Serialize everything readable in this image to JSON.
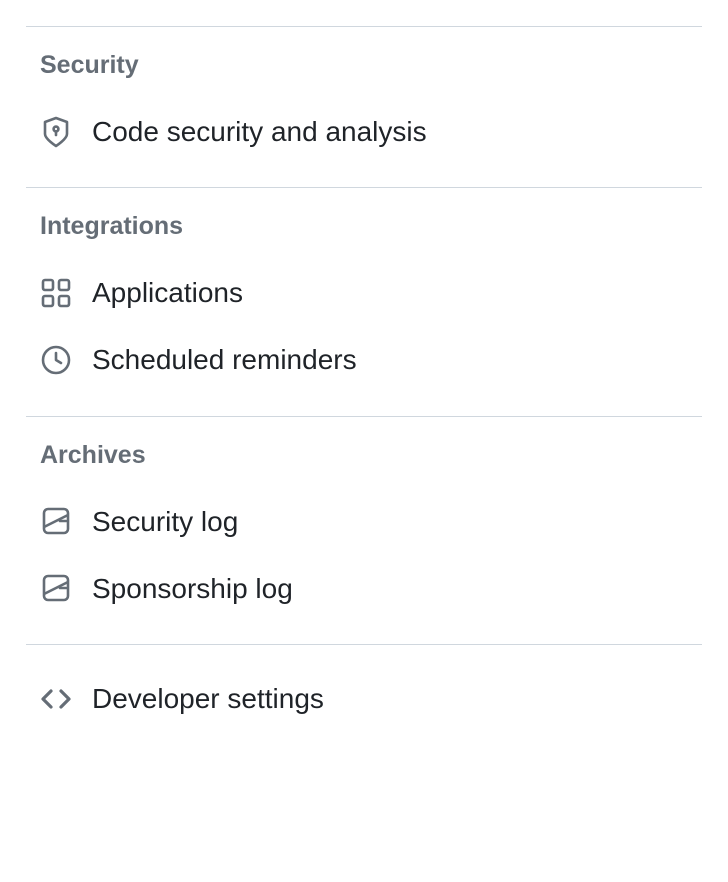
{
  "sections": {
    "security": {
      "header": "Security",
      "items": [
        {
          "label": "Code security and analysis"
        }
      ]
    },
    "integrations": {
      "header": "Integrations",
      "items": [
        {
          "label": "Applications"
        },
        {
          "label": "Scheduled reminders"
        }
      ]
    },
    "archives": {
      "header": "Archives",
      "items": [
        {
          "label": "Security log"
        },
        {
          "label": "Sponsorship log"
        }
      ]
    },
    "standalone": {
      "items": [
        {
          "label": "Developer settings"
        }
      ]
    }
  },
  "colors": {
    "headerText": "#656d76",
    "bodyText": "#1f2328",
    "iconStroke": "#656d76",
    "divider": "#d0d7de"
  }
}
